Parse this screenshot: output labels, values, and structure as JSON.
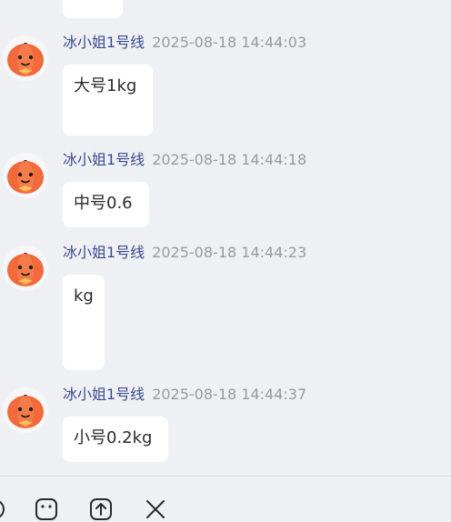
{
  "messages": [
    {
      "sender": "冰小姐1号线",
      "time": "2025-08-18 14:44:03",
      "text": "大号1kg"
    },
    {
      "sender": "冰小姐1号线",
      "time": "2025-08-18 14:44:18",
      "text": "中号0.6"
    },
    {
      "sender": "冰小姐1号线",
      "time": "2025-08-18 14:44:23",
      "text": "kg"
    },
    {
      "sender": "冰小姐1号线",
      "time": "2025-08-18 14:44:37",
      "text": "小号0.2kg"
    }
  ],
  "toolbar": {
    "icons": [
      "emoji-icon",
      "sticker-icon",
      "upload-icon",
      "close-icon"
    ]
  },
  "colors": {
    "background": "#eff0f4",
    "bubble": "#ffffff",
    "sender": "#3b4a8f",
    "timestamp": "#9a9aa2",
    "avatar": "#f26a3a"
  }
}
